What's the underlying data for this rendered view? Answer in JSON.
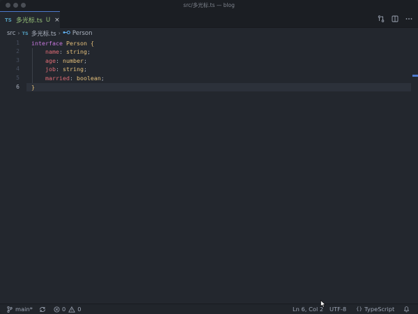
{
  "window": {
    "title": "src/多光标.ts — blog"
  },
  "tab": {
    "badge": "TS",
    "name": "多光标.ts",
    "status": "U",
    "close": "×"
  },
  "breadcrumb": {
    "folder": "src",
    "file_badge": "TS",
    "file": "多光标.ts",
    "symbol": "Person"
  },
  "editor": {
    "line_numbers": [
      "1",
      "2",
      "3",
      "4",
      "5",
      "6"
    ],
    "lines": [
      {
        "kw": "interface",
        "name": "Person",
        "open": "{"
      },
      {
        "prop": "name",
        "colon": ":",
        "type": "string",
        "semi": ";"
      },
      {
        "prop": "age",
        "colon": ":",
        "type": "number",
        "semi": ";"
      },
      {
        "prop": "job",
        "colon": ":",
        "type": "string",
        "semi": ";"
      },
      {
        "prop": "married",
        "colon": ":",
        "type": "boolean",
        "semi": ";"
      },
      {
        "close": "}"
      }
    ]
  },
  "status": {
    "branch": "main*",
    "errors": "0",
    "warnings": "0",
    "position": "Ln 6, Col 2",
    "encoding": "UTF-8",
    "language_braces": "{ }",
    "language": "TypeScript"
  },
  "colors": {
    "accent": "#4d78cc",
    "ts_badge": "#519aba",
    "untracked": "#98c379"
  }
}
